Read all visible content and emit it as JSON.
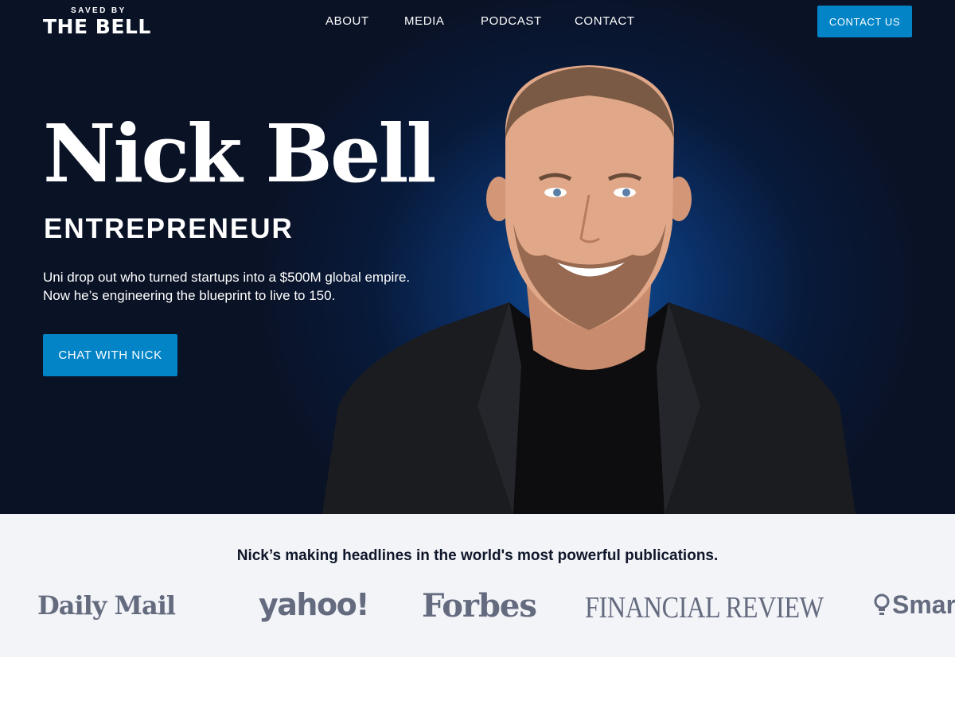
{
  "nav": {
    "logo_top": "SAVED BY",
    "logo_main": "THE BELL",
    "items": [
      "ABOUT",
      "MEDIA",
      "PODCAST",
      "CONTACT"
    ],
    "contact_button": "CONTACT US"
  },
  "hero": {
    "name": "Nick Bell",
    "role": "ENTREPRENEUR",
    "description_line1": "Uni drop out who turned startups into a $500M global empire.",
    "description_line2": "Now he’s engineering the blueprint to live to 150.",
    "cta": "CHAT WITH NICK"
  },
  "press": {
    "heading": "Nick’s making headlines in the world's most powerful publications.",
    "logos": [
      "Daily Mail",
      "yahoo!",
      "Forbes",
      "FINANCIAL REVIEW",
      "Smar"
    ]
  },
  "colors": {
    "accent": "#0284c7",
    "hero_bg": "#0a1226",
    "press_bg": "#f3f4f8",
    "logo_gray": "#646b7f"
  }
}
